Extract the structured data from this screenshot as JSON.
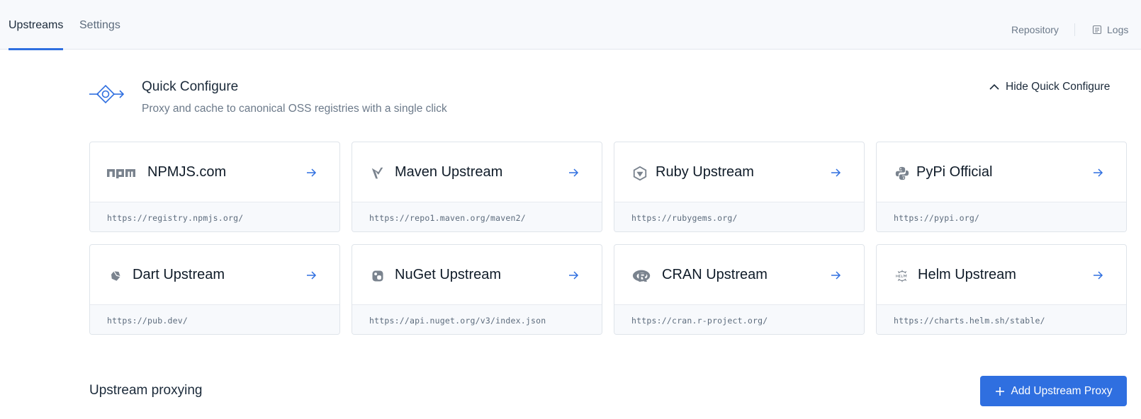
{
  "tabs": [
    {
      "label": "Upstreams",
      "active": true
    },
    {
      "label": "Settings",
      "active": false
    }
  ],
  "top_links": {
    "repository": "Repository",
    "logs": "Logs",
    "logs_icon": "list-doc-icon"
  },
  "quick_configure": {
    "icon": "node-link-icon",
    "title": "Quick Configure",
    "subtitle": "Proxy and cache to canonical OSS registries with a single click",
    "hide_label": "Hide Quick Configure",
    "hide_icon": "chevron-up-icon"
  },
  "cards": [
    {
      "name": "NPMJS.com",
      "url": "https://registry.npmjs.org/",
      "icon": "npm-icon"
    },
    {
      "name": "Maven Upstream",
      "url": "https://repo1.maven.org/maven2/",
      "icon": "maven-icon"
    },
    {
      "name": "Ruby Upstream",
      "url": "https://rubygems.org/",
      "icon": "ruby-icon"
    },
    {
      "name": "PyPi Official",
      "url": "https://pypi.org/",
      "icon": "python-icon"
    },
    {
      "name": "Dart Upstream",
      "url": "https://pub.dev/",
      "icon": "dart-icon"
    },
    {
      "name": "NuGet Upstream",
      "url": "https://api.nuget.org/v3/index.json",
      "icon": "nuget-icon"
    },
    {
      "name": "CRAN Upstream",
      "url": "https://cran.r-project.org/",
      "icon": "r-icon"
    },
    {
      "name": "Helm Upstream",
      "url": "https://charts.helm.sh/stable/",
      "icon": "helm-icon"
    }
  ],
  "upstream_section": {
    "title": "Upstream proxying",
    "add_button": "Add Upstream Proxy",
    "add_icon": "plus-icon"
  },
  "colors": {
    "accent": "#2f6fe0",
    "topbar_bg": "#f7f9fc",
    "border": "#dfe4ea",
    "muted_text": "#6c7a8a",
    "icon_gray": "#7a838e"
  }
}
